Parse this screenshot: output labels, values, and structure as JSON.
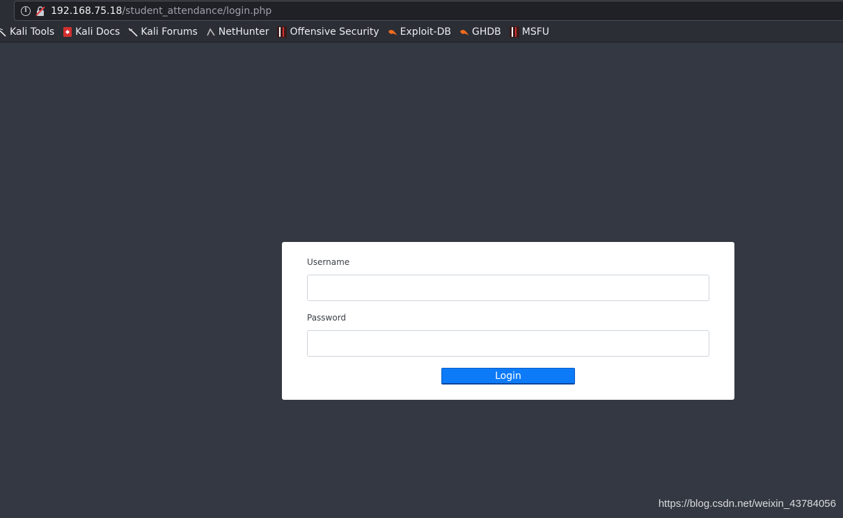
{
  "browser": {
    "url_host": "192.168.75.18",
    "url_path": "/student_attendance/login.php",
    "info_icon": "info-circle-icon",
    "insecure_icon": "insecure-lock-icon",
    "bookmarks": [
      {
        "label": "Kali Tools",
        "icon": "kali-dragon-icon"
      },
      {
        "label": "Kali Docs",
        "icon": "kali-docs-icon"
      },
      {
        "label": "Kali Forums",
        "icon": "kali-dragon-icon"
      },
      {
        "label": "NetHunter",
        "icon": "nethunter-icon"
      },
      {
        "label": "Offensive Security",
        "icon": "offsec-icon"
      },
      {
        "label": "Exploit-DB",
        "icon": "exploit-db-icon"
      },
      {
        "label": "GHDB",
        "icon": "ghdb-icon"
      },
      {
        "label": "MSFU",
        "icon": "msfu-icon"
      }
    ]
  },
  "login_form": {
    "username_label": "Username",
    "username_value": "",
    "password_label": "Password",
    "password_value": "",
    "login_button": "Login"
  },
  "colors": {
    "page_background": "#343842",
    "card_background": "#ffffff",
    "button_primary": "#0d7bf7"
  },
  "watermark": "https://blog.csdn.net/weixin_43784056"
}
